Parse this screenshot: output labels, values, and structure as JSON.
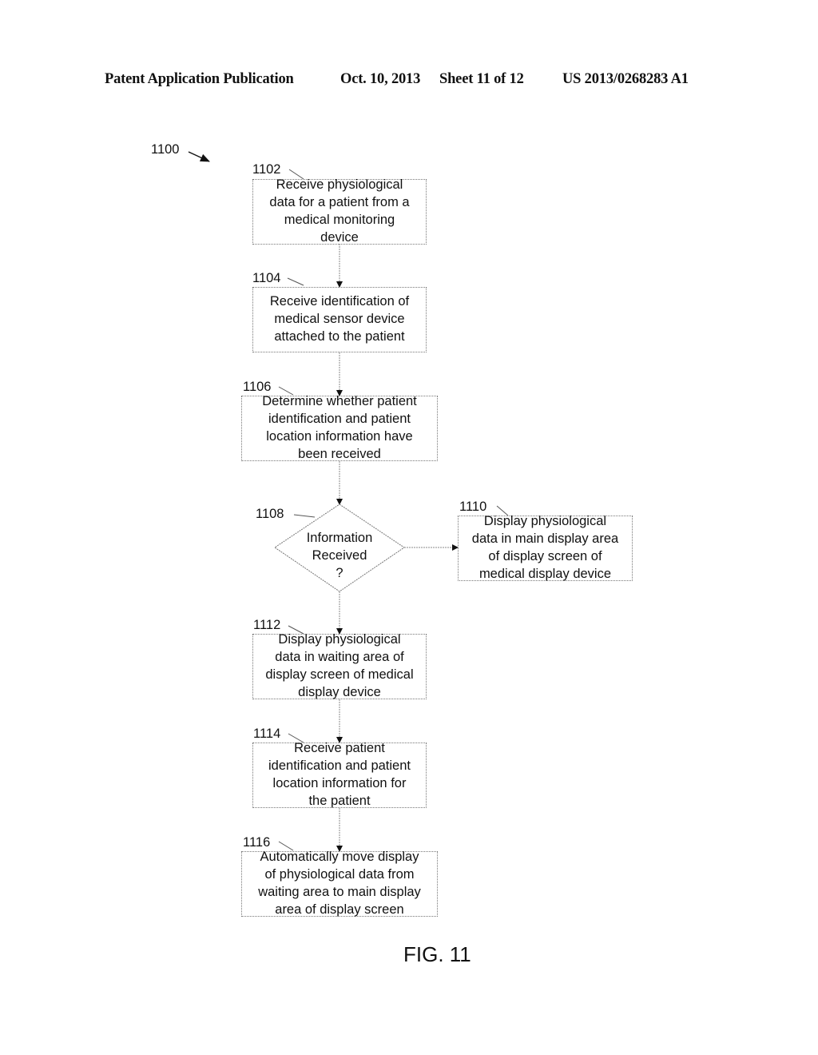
{
  "header": {
    "publication": "Patent Application Publication",
    "date": "Oct. 10, 2013",
    "sheet": "Sheet 11 of 12",
    "number": "US 2013/0268283 A1"
  },
  "diagram": {
    "ref": "1100",
    "steps": [
      {
        "ref": "1102",
        "type": "process",
        "lines": [
          "Receive physiological",
          "data for a patient from a",
          "medical monitoring",
          "device"
        ]
      },
      {
        "ref": "1104",
        "type": "process",
        "lines": [
          "Receive identification of",
          "medical sensor device",
          "attached to the patient"
        ]
      },
      {
        "ref": "1106",
        "type": "process",
        "lines": [
          "Determine whether patient",
          "identification and patient",
          "location information have",
          "been received"
        ]
      },
      {
        "ref": "1108",
        "type": "decision",
        "lines": [
          "Information",
          "Received",
          "?"
        ]
      },
      {
        "ref": "1110",
        "type": "process",
        "lines": [
          "Display physiological",
          "data in main display area",
          "of display screen of",
          "medical display device"
        ]
      },
      {
        "ref": "1112",
        "type": "process",
        "lines": [
          "Display physiological",
          "data in waiting area of",
          "display screen of medical",
          "display device"
        ]
      },
      {
        "ref": "1114",
        "type": "process",
        "lines": [
          "Receive patient",
          "identification and patient",
          "location information for",
          "the patient"
        ]
      },
      {
        "ref": "1116",
        "type": "process",
        "lines": [
          "Automatically move display",
          "of physiological data from",
          "waiting area to main display",
          "area of display screen"
        ]
      }
    ]
  },
  "figure_label": "FIG. 11"
}
